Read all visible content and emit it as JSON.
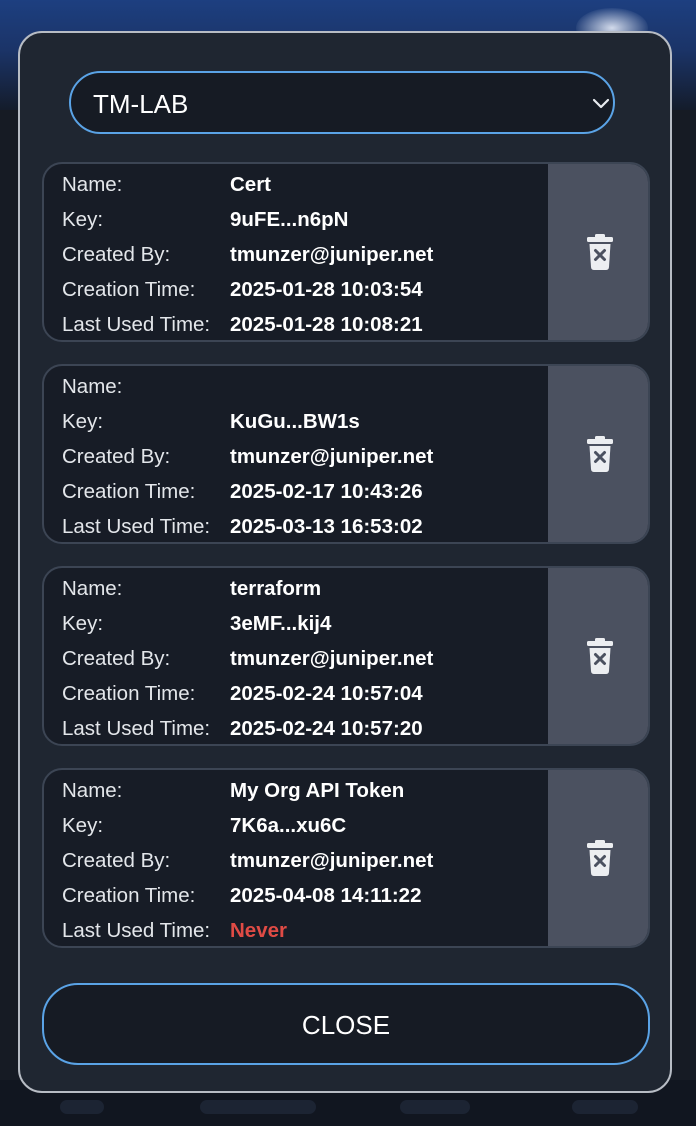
{
  "org_select": {
    "selected": "TM-LAB"
  },
  "labels": {
    "name": "Name:",
    "key": "Key:",
    "created_by": "Created By:",
    "creation_time": "Creation Time:",
    "last_used_time": "Last Used Time:"
  },
  "tokens": [
    {
      "name": "Cert",
      "key": "9uFE...n6pN",
      "created_by": "tmunzer@juniper.net",
      "creation_time": "2025-01-28 10:03:54",
      "last_used_time": "2025-01-28 10:08:21"
    },
    {
      "name": "",
      "key": "KuGu...BW1s",
      "created_by": "tmunzer@juniper.net",
      "creation_time": "2025-02-17 10:43:26",
      "last_used_time": "2025-03-13 16:53:02"
    },
    {
      "name": "terraform",
      "key": "3eMF...kij4",
      "created_by": "tmunzer@juniper.net",
      "creation_time": "2025-02-24 10:57:04",
      "last_used_time": "2025-02-24 10:57:20"
    },
    {
      "name": "My Org API Token",
      "key": "7K6a...xu6C",
      "created_by": "tmunzer@juniper.net",
      "creation_time": "2025-04-08 14:11:22",
      "last_used_time": "Never"
    }
  ],
  "close_button": {
    "label": "CLOSE"
  },
  "colors": {
    "accent": "#5aa3e6",
    "never": "#e04b45",
    "card_bg": "#171c26",
    "delete_bg": "#4b5160"
  },
  "icons": {
    "delete": "trash-icon",
    "dropdown": "chevron-down-icon"
  }
}
